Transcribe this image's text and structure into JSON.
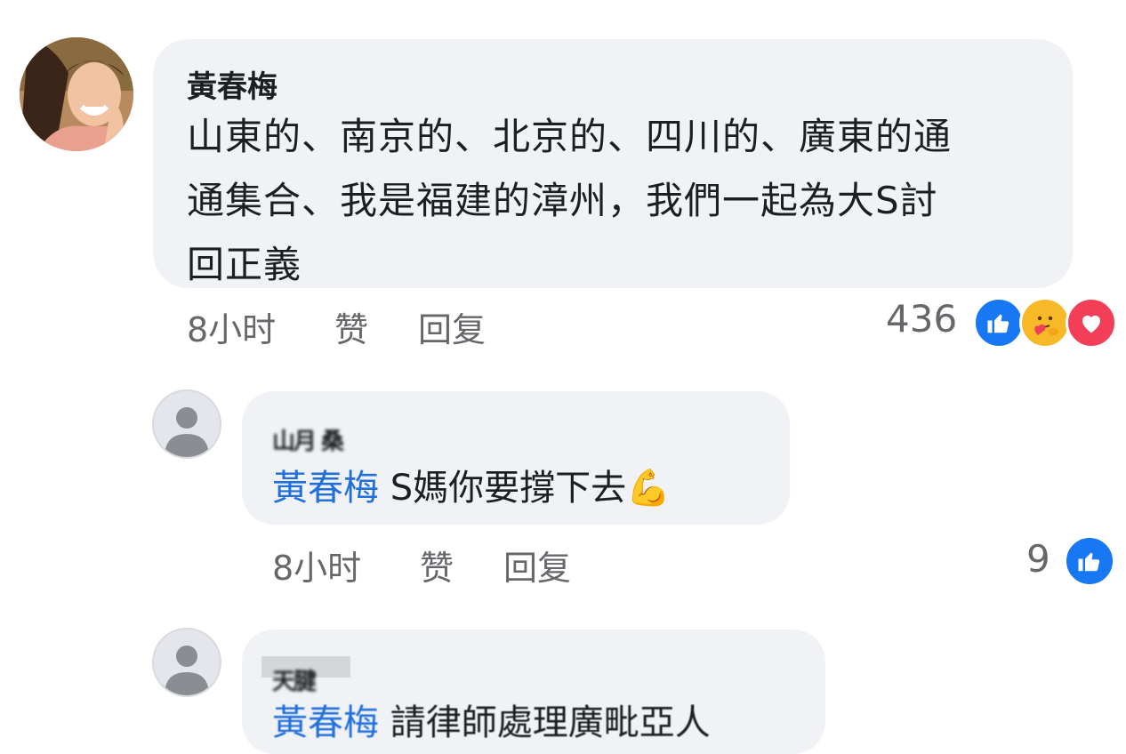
{
  "main_comment": {
    "author": "黃春梅",
    "lines": [
      "山東的、南京的、北京的、四川的、廣東的通",
      "通集合、我是福建的漳州，我們一起為大S討",
      "回正義"
    ],
    "time": "8小时",
    "like_label": "赞",
    "reply_label": "回复",
    "reaction_count": "436",
    "reactions": [
      "like-icon",
      "care-icon",
      "love-icon"
    ]
  },
  "reply1": {
    "author_blurred": "山月 桑",
    "mention": "黃春梅",
    "text": " S媽你要撐下去",
    "emoji": "💪",
    "time": "8小时",
    "like_label": "赞",
    "reply_label": "回复",
    "reaction_count": "9"
  },
  "reply2": {
    "author_blurred": "天腱",
    "mention": "黃春梅",
    "text": " 請律師處理廣毗亞人"
  },
  "colors": {
    "like": "#1877f2",
    "care": "#f7b928",
    "love": "#f33e58",
    "mention": "#216fdb",
    "bubble": "#f0f2f5",
    "meta": "#65676b"
  }
}
